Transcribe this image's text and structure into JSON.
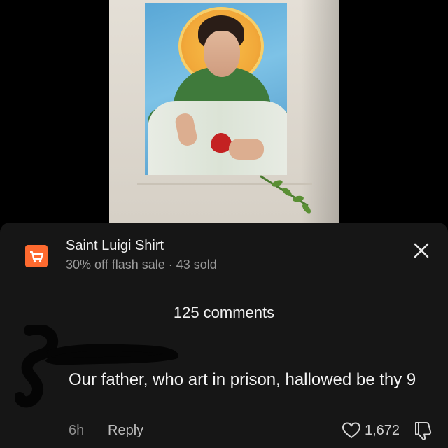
{
  "product": {
    "title": "Saint Luigi Shirt",
    "subtitle": "30% off flash sale · 43 sold",
    "icon": "shopping-cart-icon",
    "accent_color": "#fe6a2f"
  },
  "comments_header": {
    "count_label": "125 comments"
  },
  "comment": {
    "text": "Our father, who art in prison, hallowed be thy 9",
    "time": "6h",
    "reply_label": "Reply",
    "like_count": "1,672",
    "like_icon": "heart-outline-icon",
    "dislike_icon": "thumbs-down-icon"
  },
  "close_icon": "close-icon"
}
